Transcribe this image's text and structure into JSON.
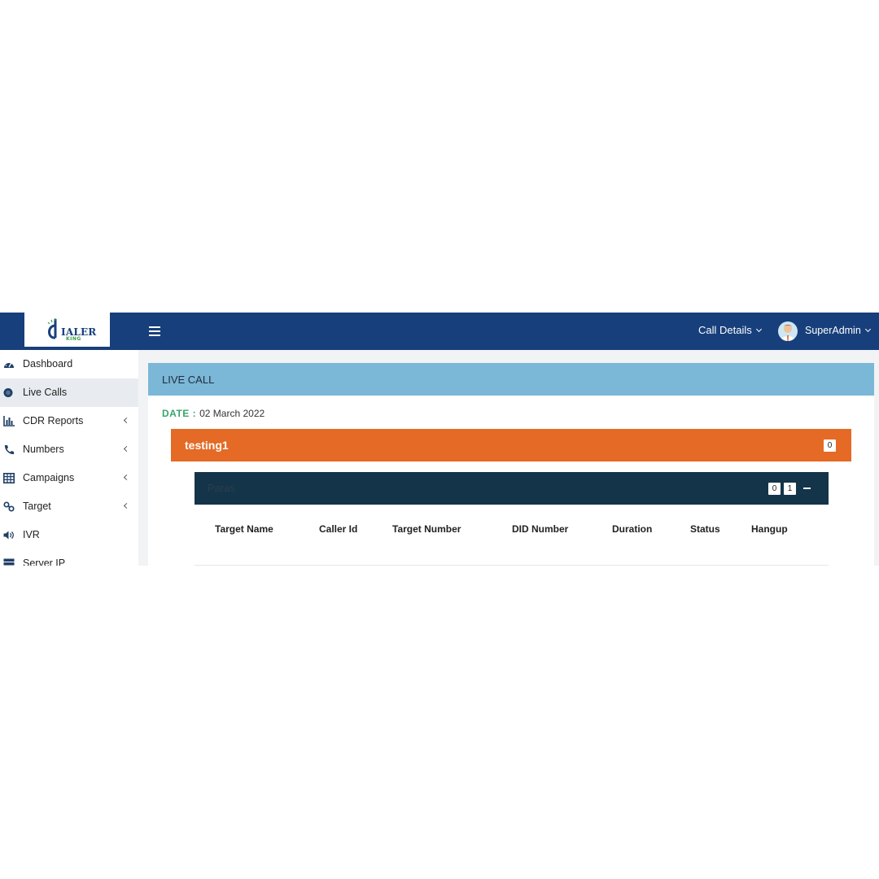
{
  "brand": {
    "logo_text": "IALER",
    "logo_sub": "KING",
    "colors": {
      "primary": "#173f7b",
      "accent_green": "#3a9c47"
    }
  },
  "header": {
    "menu_icon": "hamburger-icon",
    "call_details_label": "Call Details",
    "user_name": "SuperAdmin"
  },
  "sidebar": {
    "items": [
      {
        "label": "Dashboard",
        "icon": "dashboard-gauge-icon",
        "has_children": false,
        "active": false
      },
      {
        "label": "Live Calls",
        "icon": "record-dot-icon",
        "has_children": false,
        "active": true
      },
      {
        "label": "CDR Reports",
        "icon": "bar-chart-icon",
        "has_children": true,
        "active": false
      },
      {
        "label": "Numbers",
        "icon": "phone-icon",
        "has_children": true,
        "active": false
      },
      {
        "label": "Campaigns",
        "icon": "table-grid-icon",
        "has_children": true,
        "active": false
      },
      {
        "label": "Target",
        "icon": "link-icon",
        "has_children": true,
        "active": false
      },
      {
        "label": "IVR",
        "icon": "speaker-icon",
        "has_children": false,
        "active": false
      },
      {
        "label": "Server IP",
        "icon": "server-icon",
        "has_children": false,
        "active": false
      }
    ]
  },
  "panel": {
    "title": "LIVE CALL",
    "date_label": "DATE :",
    "date_value": "02 March 2022",
    "group": {
      "title": "testing1",
      "count": "0",
      "color": "#e46a26",
      "sub": {
        "title": "Paras",
        "badge_a": "0",
        "badge_b": "1",
        "collapse_icon": "minus-icon",
        "color": "#14344a"
      }
    },
    "columns": [
      "Target Name",
      "Caller Id",
      "Target Number",
      "DID Number",
      "Duration",
      "Status",
      "Hangup"
    ]
  }
}
